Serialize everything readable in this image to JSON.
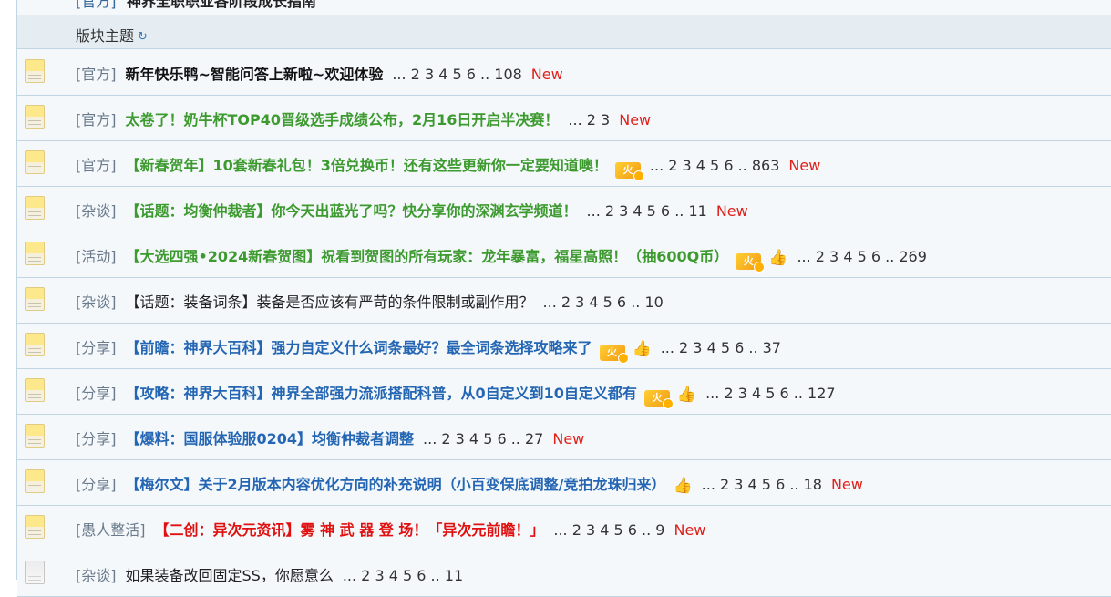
{
  "top_row": {
    "tag": "[官方]",
    "title": "神界全职职业各阶段成长指南"
  },
  "section": {
    "label": "版块主题"
  },
  "threads": [
    {
      "tag": "[官方]",
      "title": "新年快乐鸭~智能问答上新啦~欢迎体验",
      "style": "black",
      "pages": "... 2 3 4 5 6 .. 108",
      "new": "New",
      "hot": false,
      "thumb": false,
      "icon": "yellow-doc"
    },
    {
      "tag": "[官方]",
      "title": "太卷了！奶牛杯TOP40晋级选手成绩公布，2月16日开启半决赛！",
      "style": "green",
      "pages": "... 2 3",
      "new": "New",
      "hot": false,
      "thumb": false,
      "icon": "yellow-doc"
    },
    {
      "tag": "[官方]",
      "title": "【新春贺年】10套新春礼包！3倍兑换币！还有这些更新你一定要知道噢！",
      "style": "green",
      "pages": "... 2 3 4 5 6 .. 863",
      "new": "New",
      "hot": true,
      "thumb": false,
      "icon": "yellow-doc"
    },
    {
      "tag": "[杂谈]",
      "title": "【话题：均衡仲裁者】你今天出蓝光了吗？快分享你的深渊玄学频道！",
      "style": "green",
      "pages": "... 2 3 4 5 6 .. 11",
      "new": "New",
      "hot": false,
      "thumb": false,
      "icon": "yellow-doc"
    },
    {
      "tag": "[活动]",
      "title": "【大选四强•2024新春贺图】祝看到贺图的所有玩家：龙年暴富，福星高照！（抽600Q币）",
      "style": "green",
      "pages": "... 2 3 4 5 6 .. 269",
      "new": "",
      "hot": true,
      "thumb": true,
      "icon": "yellow-doc"
    },
    {
      "tag": "[杂谈]",
      "title": "【话题：装备词条】装备是否应该有严苛的条件限制或副作用？",
      "style": "plain",
      "pages": "... 2 3 4 5 6 .. 10",
      "new": "",
      "hot": false,
      "thumb": false,
      "icon": "yellow-doc"
    },
    {
      "tag": "[分享]",
      "title": "【前瞻：神界大百科】强力自定义什么词条最好？最全词条选择攻略来了",
      "style": "blue",
      "pages": "... 2 3 4 5 6 .. 37",
      "new": "",
      "hot": true,
      "thumb": true,
      "icon": "yellow-doc"
    },
    {
      "tag": "[分享]",
      "title": "【攻略：神界大百科】神界全部强力流派搭配科普，从0自定义到10自定义都有",
      "style": "blue",
      "pages": "... 2 3 4 5 6 .. 127",
      "new": "",
      "hot": true,
      "thumb": true,
      "icon": "yellow-doc"
    },
    {
      "tag": "[分享]",
      "title": "【爆料：国服体验服0204】均衡仲裁者调整",
      "style": "blue",
      "pages": "... 2 3 4 5 6 .. 27",
      "new": "New",
      "hot": false,
      "thumb": false,
      "icon": "yellow-doc"
    },
    {
      "tag": "[分享]",
      "title": "【梅尔文】关于2月版本内容优化方向的补充说明（小百变保底调整/竞拍龙珠归来）",
      "style": "blue",
      "pages": "... 2 3 4 5 6 .. 18",
      "new": "New",
      "hot": false,
      "thumb": true,
      "icon": "yellow-doc"
    },
    {
      "tag": "[愚人整活]",
      "title": "【二创：异次元资讯】雾 神 武 器 登 场！「异次元前瞻！」",
      "style": "red",
      "pages": "... 2 3 4 5 6 .. 9",
      "new": "New",
      "hot": false,
      "thumb": false,
      "icon": "yellow-doc"
    },
    {
      "tag": "[杂谈]",
      "title": "如果装备改回固定SS，你愿意么",
      "style": "plain",
      "pages": "... 2 3 4 5 6 .. 11",
      "new": "",
      "hot": false,
      "thumb": false,
      "icon": "gray-doc"
    }
  ],
  "icons": {
    "hot_text": "火"
  }
}
